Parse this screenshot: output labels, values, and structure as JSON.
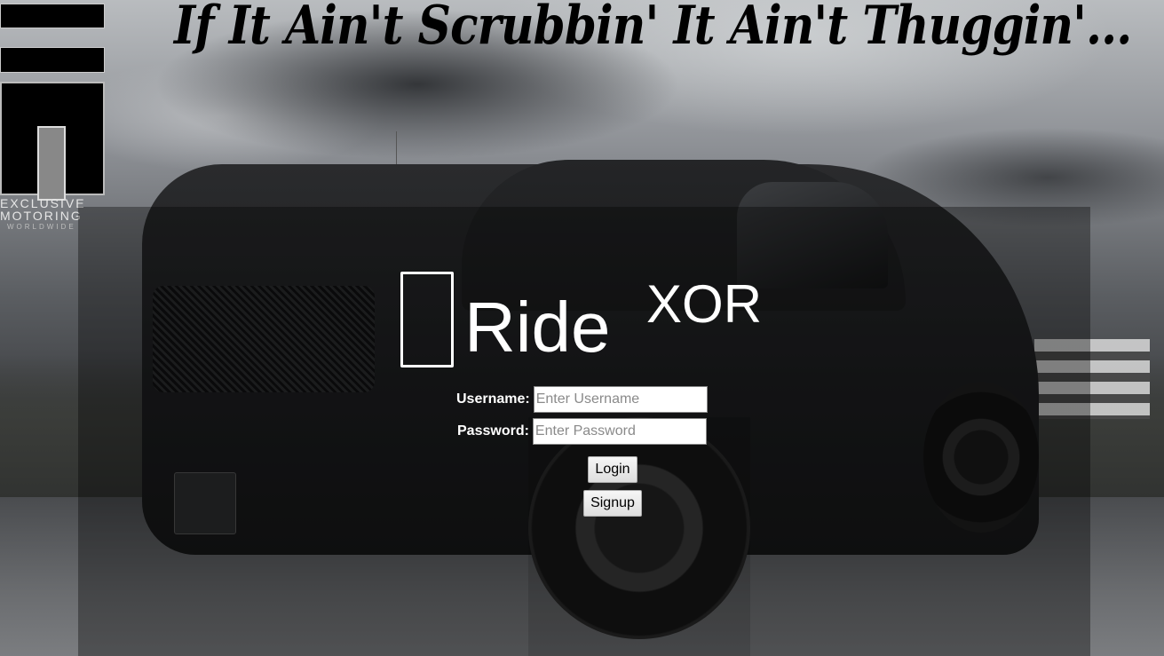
{
  "header": {
    "headline": "If It Ain't Scrubbin' It Ain't Thuggin'..."
  },
  "logo": {
    "line1": "EXCLUSIVE",
    "line2": "MOTORING",
    "line3": "WORLDWIDE"
  },
  "brand": {
    "icon": "car-icon",
    "word": "Ride",
    "superscript": "XOR"
  },
  "login_form": {
    "username_label": "Username:",
    "username_placeholder": "Enter Username",
    "username_value": "",
    "password_label": "Password:",
    "password_placeholder": "Enter Password",
    "password_value": "",
    "login_label": "Login",
    "signup_label": "Signup"
  }
}
